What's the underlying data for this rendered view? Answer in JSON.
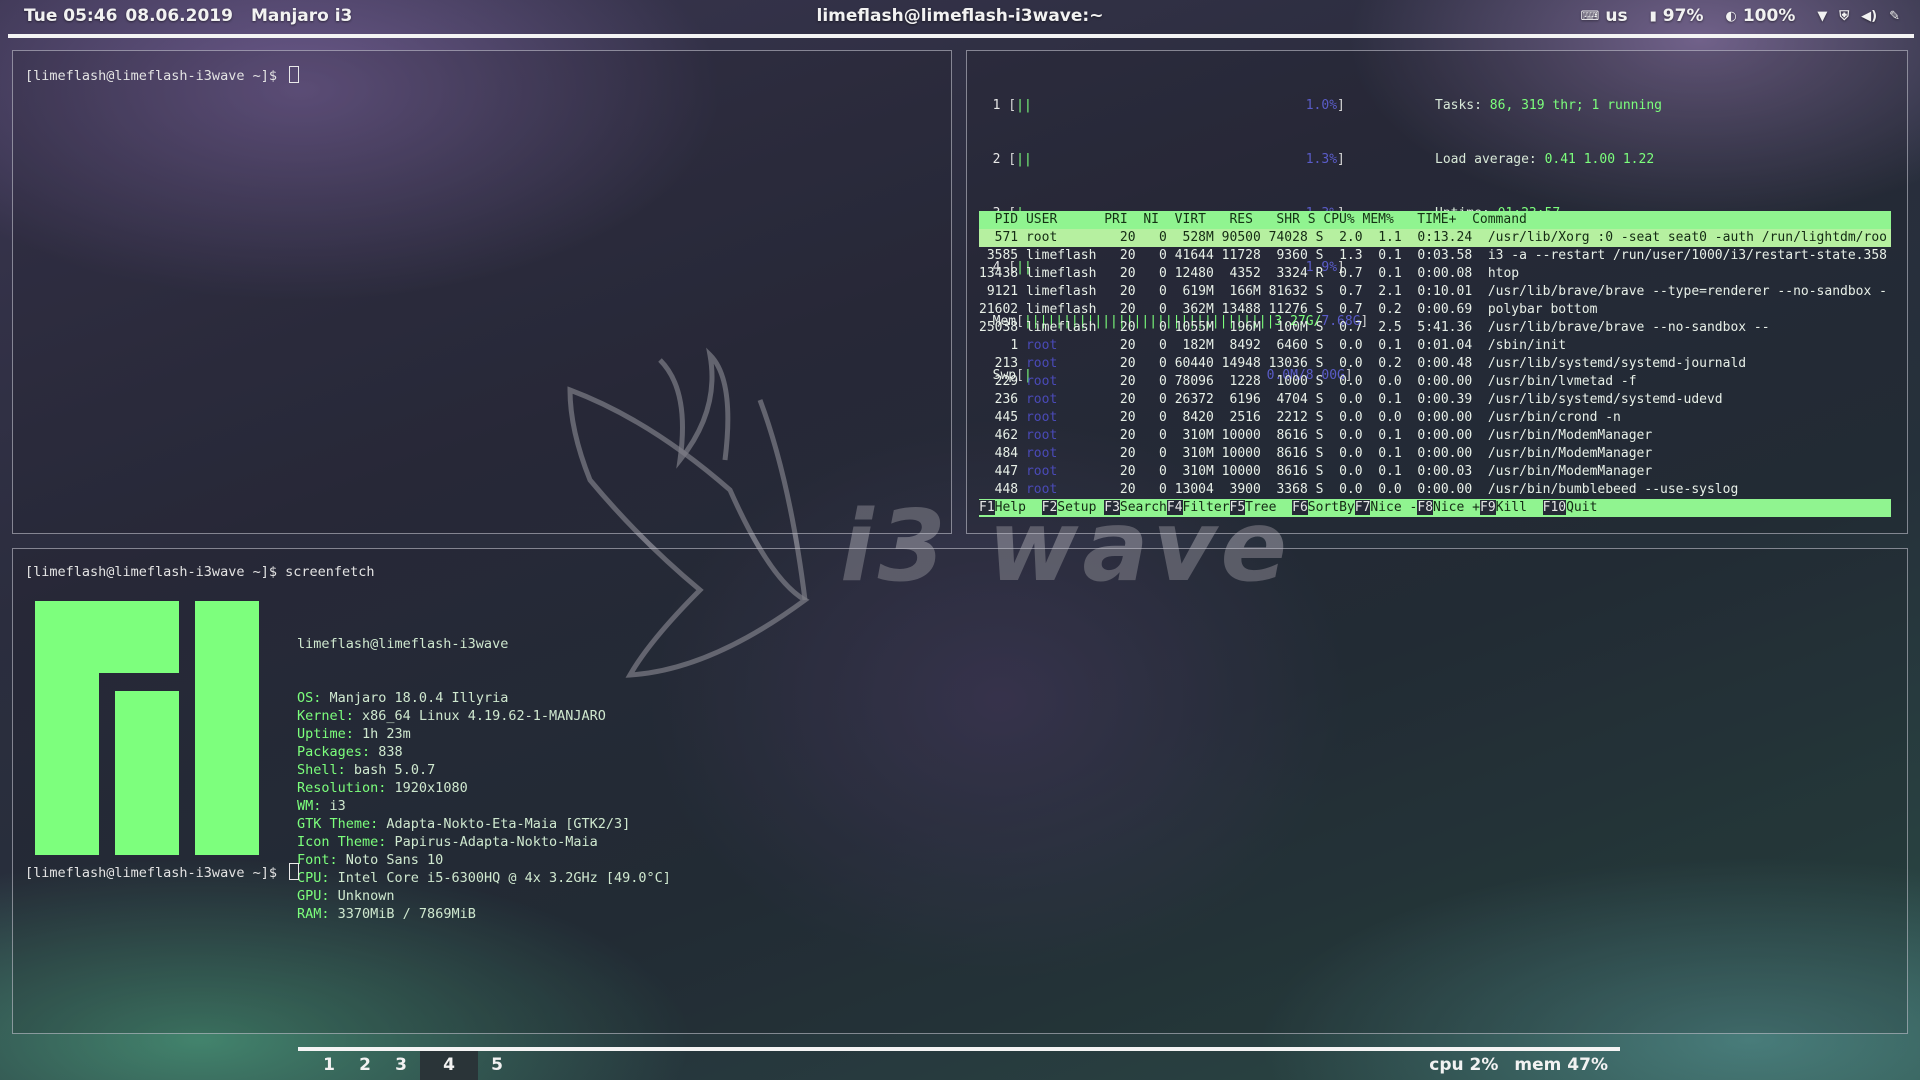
{
  "topbar": {
    "datetime": "Tue 05:46",
    "date": "08.06.2019",
    "distro": "Manjaro i3",
    "window_title": "limeflash@limeflash-i3wave:~",
    "keyboard": "us",
    "battery": "97%",
    "brightness": "100%"
  },
  "term1": {
    "prompt": "[limeflash@limeflash-i3wave ~]$ "
  },
  "htop": {
    "meters": [
      {
        "n": "1",
        "v": "1.0%"
      },
      {
        "n": "2",
        "v": "1.3%"
      },
      {
        "n": "3",
        "v": "1.3%"
      },
      {
        "n": "4",
        "v": "1.9%"
      }
    ],
    "mem_label": "Mem",
    "mem_value": "3.27G/",
    "mem_total": "7.68G",
    "swp_label": "Swp",
    "swp_value": "0.0M/8.00G",
    "tasks_label": "Tasks: ",
    "tasks": "86, 319 thr; 1 running",
    "load_label": "Load average: ",
    "load": "0.41 1.00 1.22",
    "uptime_label": "Uptime: ",
    "uptime": "01:23:57",
    "header": "  PID USER      PRI  NI  VIRT   RES   SHR S CPU% MEM%   TIME+  Command",
    "rows": [
      {
        "pid": "571",
        "user": "root",
        "pri": "20",
        "ni": "0",
        "virt": "528M",
        "res": "90500",
        "shr": "74028",
        "s": "S",
        "cpu": "2.0",
        "mem": "1.1",
        "time": "0:13.24",
        "cmd": "/usr/lib/Xorg :0 -seat seat0 -auth /run/lightdm/roo"
      },
      {
        "pid": "3585",
        "user": "limeflash",
        "pri": "20",
        "ni": "0",
        "virt": "41644",
        "res": "11728",
        "shr": "9360",
        "s": "S",
        "cpu": "1.3",
        "mem": "0.1",
        "time": "0:03.58",
        "cmd": "i3 -a --restart /run/user/1000/i3/restart-state.358"
      },
      {
        "pid": "13438",
        "user": "limeflash",
        "pri": "20",
        "ni": "0",
        "virt": "12480",
        "res": "4352",
        "shr": "3324",
        "s": "R",
        "cpu": "0.7",
        "mem": "0.1",
        "time": "0:00.08",
        "cmd": "htop"
      },
      {
        "pid": "9121",
        "user": "limeflash",
        "pri": "20",
        "ni": "0",
        "virt": "619M",
        "res": "166M",
        "shr": "81632",
        "s": "S",
        "cpu": "0.7",
        "mem": "2.1",
        "time": "0:10.01",
        "cmd": "/usr/lib/brave/brave --type=renderer --no-sandbox -"
      },
      {
        "pid": "21602",
        "user": "limeflash",
        "pri": "20",
        "ni": "0",
        "virt": "362M",
        "res": "13488",
        "shr": "11276",
        "s": "S",
        "cpu": "0.7",
        "mem": "0.2",
        "time": "0:00.69",
        "cmd": "polybar bottom"
      },
      {
        "pid": "25038",
        "user": "limeflash",
        "pri": "20",
        "ni": "0",
        "virt": "1055M",
        "res": "196M",
        "shr": "100M",
        "s": "S",
        "cpu": "0.7",
        "mem": "2.5",
        "time": "5:41.36",
        "cmd": "/usr/lib/brave/brave --no-sandbox --"
      },
      {
        "pid": "1",
        "user": "root",
        "pri": "20",
        "ni": "0",
        "virt": "182M",
        "res": "8492",
        "shr": "6460",
        "s": "S",
        "cpu": "0.0",
        "mem": "0.1",
        "time": "0:01.04",
        "cmd": "/sbin/init"
      },
      {
        "pid": "213",
        "user": "root",
        "pri": "20",
        "ni": "0",
        "virt": "60440",
        "res": "14948",
        "shr": "13036",
        "s": "S",
        "cpu": "0.0",
        "mem": "0.2",
        "time": "0:00.48",
        "cmd": "/usr/lib/systemd/systemd-journald"
      },
      {
        "pid": "229",
        "user": "root",
        "pri": "20",
        "ni": "0",
        "virt": "78096",
        "res": "1228",
        "shr": "1000",
        "s": "S",
        "cpu": "0.0",
        "mem": "0.0",
        "time": "0:00.00",
        "cmd": "/usr/bin/lvmetad -f"
      },
      {
        "pid": "236",
        "user": "root",
        "pri": "20",
        "ni": "0",
        "virt": "26372",
        "res": "6196",
        "shr": "4704",
        "s": "S",
        "cpu": "0.0",
        "mem": "0.1",
        "time": "0:00.39",
        "cmd": "/usr/lib/systemd/systemd-udevd"
      },
      {
        "pid": "445",
        "user": "root",
        "pri": "20",
        "ni": "0",
        "virt": "8420",
        "res": "2516",
        "shr": "2212",
        "s": "S",
        "cpu": "0.0",
        "mem": "0.0",
        "time": "0:00.00",
        "cmd": "/usr/bin/crond -n"
      },
      {
        "pid": "462",
        "user": "root",
        "pri": "20",
        "ni": "0",
        "virt": "310M",
        "res": "10000",
        "shr": "8616",
        "s": "S",
        "cpu": "0.0",
        "mem": "0.1",
        "time": "0:00.00",
        "cmd": "/usr/bin/ModemManager"
      },
      {
        "pid": "484",
        "user": "root",
        "pri": "20",
        "ni": "0",
        "virt": "310M",
        "res": "10000",
        "shr": "8616",
        "s": "S",
        "cpu": "0.0",
        "mem": "0.1",
        "time": "0:00.00",
        "cmd": "/usr/bin/ModemManager"
      },
      {
        "pid": "447",
        "user": "root",
        "pri": "20",
        "ni": "0",
        "virt": "310M",
        "res": "10000",
        "shr": "8616",
        "s": "S",
        "cpu": "0.0",
        "mem": "0.1",
        "time": "0:00.03",
        "cmd": "/usr/bin/ModemManager"
      },
      {
        "pid": "448",
        "user": "root",
        "pri": "20",
        "ni": "0",
        "virt": "13004",
        "res": "3900",
        "shr": "3368",
        "s": "S",
        "cpu": "0.0",
        "mem": "0.0",
        "time": "0:00.00",
        "cmd": "/usr/bin/bumblebeed --use-syslog"
      }
    ],
    "fkeys": [
      {
        "k": "F1",
        "l": "Help  "
      },
      {
        "k": "F2",
        "l": "Setup "
      },
      {
        "k": "F3",
        "l": "Search"
      },
      {
        "k": "F4",
        "l": "Filter"
      },
      {
        "k": "F5",
        "l": "Tree  "
      },
      {
        "k": "F6",
        "l": "SortBy"
      },
      {
        "k": "F7",
        "l": "Nice -"
      },
      {
        "k": "F8",
        "l": "Nice +"
      },
      {
        "k": "F9",
        "l": "Kill  "
      },
      {
        "k": "F10",
        "l": "Quit"
      }
    ]
  },
  "term2": {
    "prompt": "[limeflash@limeflash-i3wave ~]$ ",
    "command": "screenfetch",
    "host": "limeflash@limeflash-i3wave",
    "info": [
      {
        "k": "OS:",
        "v": "Manjaro 18.0.4 Illyria"
      },
      {
        "k": "Kernel:",
        "v": "x86_64 Linux 4.19.62-1-MANJARO"
      },
      {
        "k": "Uptime:",
        "v": "1h 23m"
      },
      {
        "k": "Packages:",
        "v": "838"
      },
      {
        "k": "Shell:",
        "v": "bash 5.0.7"
      },
      {
        "k": "Resolution:",
        "v": "1920x1080"
      },
      {
        "k": "WM:",
        "v": "i3"
      },
      {
        "k": "GTK Theme:",
        "v": "Adapta-Nokto-Eta-Maia [GTK2/3]"
      },
      {
        "k": "Icon Theme:",
        "v": "Papirus-Adapta-Nokto-Maia"
      },
      {
        "k": "Font:",
        "v": "Noto Sans 10"
      },
      {
        "k": "CPU:",
        "v": "Intel Core i5-6300HQ @ 4x 3.2GHz [49.0°C]"
      },
      {
        "k": "GPU:",
        "v": "Unknown"
      },
      {
        "k": "RAM:",
        "v": "3370MiB / 7869MiB"
      }
    ],
    "prompt2": "[limeflash@limeflash-i3wave ~]$ "
  },
  "watermark": "i3 wave",
  "bottombar": {
    "workspaces": [
      "1",
      "2",
      "3",
      "4",
      "5"
    ],
    "active_workspace": "4",
    "cpu": "cpu 2%",
    "mem": "mem 47%"
  },
  "colors": {
    "accent": "#7dff7d",
    "htop_header": "#90f490",
    "root_user": "#4a4ab8"
  }
}
